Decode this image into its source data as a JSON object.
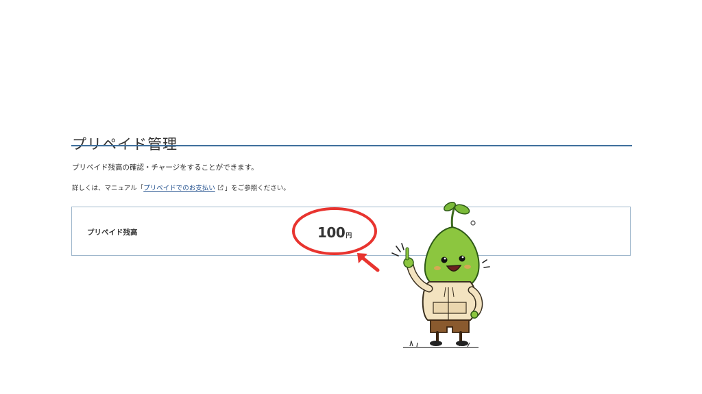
{
  "page": {
    "title": "プリペイド管理",
    "description": "プリペイド残高の確認・チャージをすることができます。",
    "note_prefix": "詳しくは、マニュアル「",
    "note_link": "プリペイドでのお支払い",
    "note_suffix": "」をご参照ください。"
  },
  "balance": {
    "label": "プリペイド残高",
    "value": "100",
    "unit": "円"
  },
  "colors": {
    "accent_rule": "#3e6f9c",
    "link": "#1f4e8c",
    "panel_border": "#9fb7cc",
    "annotation": "#e8342f"
  },
  "icons": {
    "external_link": "external-link-icon",
    "annotation_circle": "highlight-ellipse",
    "annotation_arrow": "pointer-arrow",
    "mascot": "sprout-mascot-illustration"
  }
}
